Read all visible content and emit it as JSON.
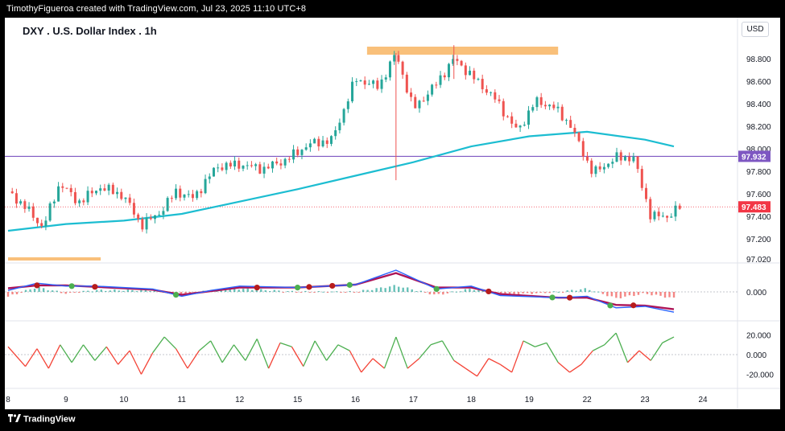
{
  "header": {
    "text": "TimothyFigueroa created with TradingView.com, Jul 23, 2025 11:10 UTC+8"
  },
  "title": "DXY . U.S. Dollar Index . 1h",
  "currency": "USD",
  "footer": {
    "brand": "TradingView"
  },
  "colors": {
    "bull": "#26a69a",
    "bear": "#ef5350",
    "ma": "#1cbdd1",
    "resistance_zone": "#f9c07a",
    "horizontal_line": "#7e57c2",
    "price_label": "#f23645",
    "level_label": "#7e57c2",
    "macd_line": "#2962ff",
    "signal_line": "#ad1457",
    "osc_up": "#4caf50",
    "osc_down": "#f44336"
  },
  "chart_data": [
    {
      "type": "candlestick",
      "title": "DXY . U.S. Dollar Index . 1h",
      "y_ticks": [
        "98.800",
        "98.600",
        "98.400",
        "98.200",
        "98.000",
        "97.800",
        "97.600",
        "97.400",
        "97.200",
        "97.020"
      ],
      "ylim": [
        97.02,
        98.95
      ],
      "x_ticks": [
        "8",
        "9",
        "10",
        "11",
        "12",
        "15",
        "16",
        "17",
        "18",
        "19",
        "22",
        "23",
        "24"
      ],
      "close_path": [
        {
          "x": 0,
          "y": 97.62
        },
        {
          "x": 0.3,
          "y": 97.48
        },
        {
          "x": 0.6,
          "y": 97.3
        },
        {
          "x": 0.9,
          "y": 97.7
        },
        {
          "x": 1.2,
          "y": 97.52
        },
        {
          "x": 1.6,
          "y": 97.66
        },
        {
          "x": 2.0,
          "y": 97.58
        },
        {
          "x": 2.3,
          "y": 97.32
        },
        {
          "x": 2.6,
          "y": 97.42
        },
        {
          "x": 2.9,
          "y": 97.62
        },
        {
          "x": 3.2,
          "y": 97.56
        },
        {
          "x": 3.6,
          "y": 97.84
        },
        {
          "x": 4.0,
          "y": 97.86
        },
        {
          "x": 4.4,
          "y": 97.82
        },
        {
          "x": 4.8,
          "y": 97.9
        },
        {
          "x": 5.2,
          "y": 98.04
        },
        {
          "x": 5.6,
          "y": 98.08
        },
        {
          "x": 6.0,
          "y": 98.62
        },
        {
          "x": 6.4,
          "y": 98.55
        },
        {
          "x": 6.7,
          "y": 98.85
        },
        {
          "x": 7.0,
          "y": 98.35
        },
        {
          "x": 7.4,
          "y": 98.58
        },
        {
          "x": 7.7,
          "y": 98.8
        },
        {
          "x": 8.1,
          "y": 98.6
        },
        {
          "x": 8.4,
          "y": 98.45
        },
        {
          "x": 8.8,
          "y": 98.15
        },
        {
          "x": 9.1,
          "y": 98.42
        },
        {
          "x": 9.4,
          "y": 98.38
        },
        {
          "x": 9.7,
          "y": 98.22
        },
        {
          "x": 9.9,
          "y": 98.0
        },
        {
          "x": 10.1,
          "y": 97.78
        },
        {
          "x": 10.5,
          "y": 97.92
        },
        {
          "x": 10.8,
          "y": 97.92
        },
        {
          "x": 11.0,
          "y": 97.58
        },
        {
          "x": 11.1,
          "y": 97.4
        },
        {
          "x": 11.4,
          "y": 97.4
        },
        {
          "x": 11.6,
          "y": 97.48
        }
      ],
      "moving_average": [
        {
          "x": 0,
          "y": 97.27
        },
        {
          "x": 1,
          "y": 97.33
        },
        {
          "x": 2,
          "y": 97.36
        },
        {
          "x": 3,
          "y": 97.42
        },
        {
          "x": 4,
          "y": 97.53
        },
        {
          "x": 5,
          "y": 97.64
        },
        {
          "x": 6,
          "y": 97.76
        },
        {
          "x": 7,
          "y": 97.88
        },
        {
          "x": 8,
          "y": 98.02
        },
        {
          "x": 9,
          "y": 98.11
        },
        {
          "x": 10,
          "y": 98.15
        },
        {
          "x": 11,
          "y": 98.08
        },
        {
          "x": 11.5,
          "y": 98.02
        }
      ],
      "resistance_zone": {
        "y_low": 98.85,
        "y_high": 98.92,
        "x_from": 6.2,
        "x_to": 9.5
      },
      "support_marker": {
        "y": 97.02,
        "x_from": 0,
        "x_to": 1.6
      },
      "horizontal_level": 97.932,
      "current_price": 97.483,
      "price_labels": {
        "level": "97.932",
        "current": "97.483"
      }
    },
    {
      "type": "line",
      "name": "MACD",
      "y_ticks": [
        "0.000"
      ],
      "macd": [
        {
          "x": 0,
          "y": 0.02
        },
        {
          "x": 0.5,
          "y": 0.12
        },
        {
          "x": 1.0,
          "y": 0.08
        },
        {
          "x": 1.5,
          "y": 0.08
        },
        {
          "x": 2.5,
          "y": 0.04
        },
        {
          "x": 3.0,
          "y": -0.06
        },
        {
          "x": 3.5,
          "y": 0.02
        },
        {
          "x": 4.0,
          "y": 0.08
        },
        {
          "x": 5.0,
          "y": 0.06
        },
        {
          "x": 6.0,
          "y": 0.1
        },
        {
          "x": 6.7,
          "y": 0.3
        },
        {
          "x": 7.4,
          "y": 0.04
        },
        {
          "x": 8.0,
          "y": 0.08
        },
        {
          "x": 8.5,
          "y": -0.05
        },
        {
          "x": 9.5,
          "y": -0.08
        },
        {
          "x": 10.0,
          "y": -0.06
        },
        {
          "x": 10.5,
          "y": -0.22
        },
        {
          "x": 11.0,
          "y": -0.2
        },
        {
          "x": 11.5,
          "y": -0.28
        }
      ],
      "signal": [
        {
          "x": 0,
          "y": 0.05
        },
        {
          "x": 0.5,
          "y": 0.09
        },
        {
          "x": 1.0,
          "y": 0.09
        },
        {
          "x": 1.5,
          "y": 0.07
        },
        {
          "x": 2.5,
          "y": 0.03
        },
        {
          "x": 3.0,
          "y": -0.04
        },
        {
          "x": 3.5,
          "y": 0.01
        },
        {
          "x": 4.0,
          "y": 0.06
        },
        {
          "x": 5.0,
          "y": 0.06
        },
        {
          "x": 6.0,
          "y": 0.1
        },
        {
          "x": 6.7,
          "y": 0.26
        },
        {
          "x": 7.4,
          "y": 0.06
        },
        {
          "x": 8.0,
          "y": 0.06
        },
        {
          "x": 8.5,
          "y": -0.03
        },
        {
          "x": 9.5,
          "y": -0.08
        },
        {
          "x": 10.0,
          "y": -0.08
        },
        {
          "x": 10.5,
          "y": -0.18
        },
        {
          "x": 11.0,
          "y": -0.19
        },
        {
          "x": 11.5,
          "y": -0.24
        }
      ],
      "cross_bull_x": [
        1.1,
        2.9,
        5.0,
        5.9,
        7.4,
        9.4,
        10.4
      ],
      "cross_bear_x": [
        0.5,
        1.5,
        4.3,
        5.2,
        5.6,
        8.3,
        9.7,
        10.8
      ]
    },
    {
      "type": "line",
      "name": "Oscillator",
      "y_ticks": [
        "20.000",
        "0.000",
        "-20.000"
      ],
      "ylim": [
        -30,
        30
      ],
      "values": [
        {
          "x": 0.0,
          "y": 8
        },
        {
          "x": 0.3,
          "y": -12
        },
        {
          "x": 0.5,
          "y": 6
        },
        {
          "x": 0.7,
          "y": -14
        },
        {
          "x": 0.9,
          "y": 10
        },
        {
          "x": 1.1,
          "y": -8
        },
        {
          "x": 1.3,
          "y": 10
        },
        {
          "x": 1.5,
          "y": -6
        },
        {
          "x": 1.7,
          "y": 8
        },
        {
          "x": 1.9,
          "y": -10
        },
        {
          "x": 2.1,
          "y": 4
        },
        {
          "x": 2.3,
          "y": -20
        },
        {
          "x": 2.5,
          "y": 2
        },
        {
          "x": 2.7,
          "y": 18
        },
        {
          "x": 2.9,
          "y": 6
        },
        {
          "x": 3.1,
          "y": -14
        },
        {
          "x": 3.3,
          "y": 4
        },
        {
          "x": 3.5,
          "y": 14
        },
        {
          "x": 3.7,
          "y": -8
        },
        {
          "x": 3.9,
          "y": 10
        },
        {
          "x": 4.1,
          "y": -6
        },
        {
          "x": 4.3,
          "y": 16
        },
        {
          "x": 4.5,
          "y": -14
        },
        {
          "x": 4.7,
          "y": 12
        },
        {
          "x": 4.9,
          "y": 8
        },
        {
          "x": 5.1,
          "y": -12
        },
        {
          "x": 5.3,
          "y": 14
        },
        {
          "x": 5.5,
          "y": -6
        },
        {
          "x": 5.7,
          "y": 10
        },
        {
          "x": 5.9,
          "y": 4
        },
        {
          "x": 6.1,
          "y": -18
        },
        {
          "x": 6.3,
          "y": -4
        },
        {
          "x": 6.5,
          "y": -14
        },
        {
          "x": 6.7,
          "y": 18
        },
        {
          "x": 6.9,
          "y": -14
        },
        {
          "x": 7.1,
          "y": -4
        },
        {
          "x": 7.3,
          "y": 10
        },
        {
          "x": 7.5,
          "y": 14
        },
        {
          "x": 7.7,
          "y": -6
        },
        {
          "x": 7.9,
          "y": -14
        },
        {
          "x": 8.1,
          "y": -22
        },
        {
          "x": 8.3,
          "y": -4
        },
        {
          "x": 8.5,
          "y": -10
        },
        {
          "x": 8.7,
          "y": -18
        },
        {
          "x": 8.9,
          "y": 14
        },
        {
          "x": 9.1,
          "y": 8
        },
        {
          "x": 9.3,
          "y": 12
        },
        {
          "x": 9.5,
          "y": -8
        },
        {
          "x": 9.7,
          "y": -18
        },
        {
          "x": 9.9,
          "y": -10
        },
        {
          "x": 10.1,
          "y": 4
        },
        {
          "x": 10.3,
          "y": 10
        },
        {
          "x": 10.5,
          "y": 22
        },
        {
          "x": 10.7,
          "y": -8
        },
        {
          "x": 10.9,
          "y": 4
        },
        {
          "x": 11.1,
          "y": -6
        },
        {
          "x": 11.3,
          "y": 12
        },
        {
          "x": 11.5,
          "y": 18
        }
      ]
    }
  ]
}
